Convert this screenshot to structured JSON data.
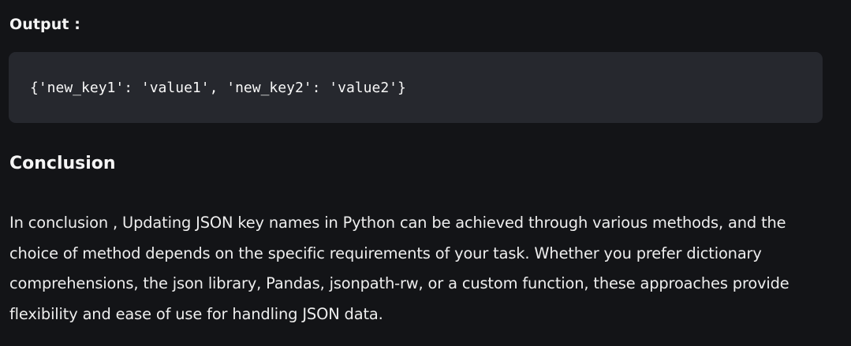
{
  "output": {
    "label": "Output :",
    "code": "{'new_key1': 'value1', 'new_key2': 'value2'}"
  },
  "conclusion": {
    "heading": "Conclusion",
    "paragraph": "In conclusion , Updating JSON key names in Python can be achieved through various methods, and the choice of method depends on the specific requirements of your task. Whether you prefer dictionary comprehensions, the json library, Pandas, jsonpath-rw, or a custom function, these approaches provide flexibility and ease of use for handling JSON data."
  },
  "colors": {
    "background": "#131417",
    "code_background": "#26282e",
    "text": "#f2f2f2"
  }
}
